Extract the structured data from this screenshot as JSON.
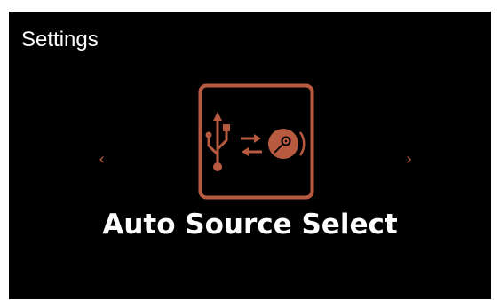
{
  "header": {
    "title": "Settings"
  },
  "navigation": {
    "prev_glyph": "‹",
    "next_glyph": "›"
  },
  "current_setting": {
    "name": "Auto Source Select",
    "icon": "usb-to-disc-icon"
  },
  "colors": {
    "background": "#000000",
    "accent": "#b85a3f",
    "text": "#ffffff"
  }
}
